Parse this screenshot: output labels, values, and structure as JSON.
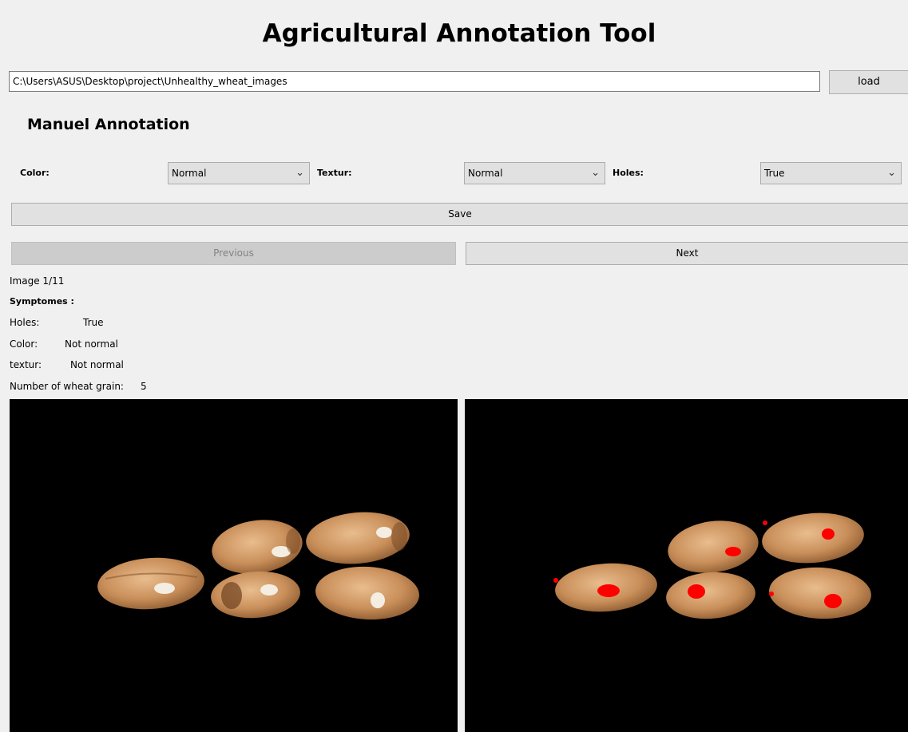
{
  "header": {
    "title": "Agricultural Annotation Tool"
  },
  "path_bar": {
    "value": "C:\\Users\\ASUS\\Desktop\\project\\Unhealthy_wheat_images",
    "load_label": "load"
  },
  "manual_annotation": {
    "title": "Manuel Annotation",
    "color_label": "Color:",
    "color_value": "Normal",
    "textur_label": "Textur:",
    "textur_value": "Normal",
    "holes_label": "Holes:",
    "holes_value": "True",
    "save_label": "Save"
  },
  "navigation": {
    "previous_label": "Previous",
    "next_label": "Next"
  },
  "info": {
    "image_counter": "Image 1/11",
    "symptoms_heading": "Symptomes :",
    "holes_label": "Holes:",
    "holes_value": "True",
    "color_label": "Color:",
    "color_value": "Not normal",
    "textur_label": "textur:",
    "textur_value": "Not normal",
    "grain_count_label": "Number of wheat grain:",
    "grain_count_value": "5"
  },
  "images": {
    "left": "original-wheat-image",
    "right": "annotated-wheat-image",
    "highlight_color": "#ff0000"
  },
  "colors": {
    "window_bg": "#f0f0f0",
    "button_bg": "#e1e1e1",
    "disabled_button_bg": "#cccccc",
    "image_bg": "#000000"
  }
}
